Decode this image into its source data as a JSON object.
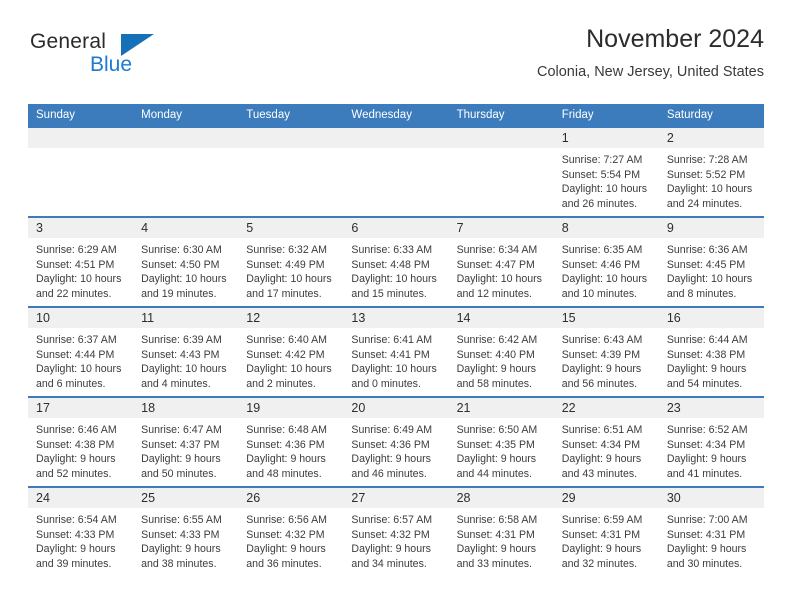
{
  "brand": {
    "name_part1": "General",
    "name_part2": "Blue",
    "logo_icon": "blue-triangle-icon"
  },
  "header": {
    "title": "November 2024",
    "location": "Colonia, New Jersey, United States"
  },
  "colors": {
    "header_blue": "#3c7cbd",
    "brand_blue": "#1c7ad1",
    "daynum_band": "#f0f0f0",
    "text": "#333333"
  },
  "weekday_headers": [
    "Sunday",
    "Monday",
    "Tuesday",
    "Wednesday",
    "Thursday",
    "Friday",
    "Saturday"
  ],
  "labels": {
    "sunrise_prefix": "Sunrise:",
    "sunset_prefix": "Sunset:",
    "daylight_prefix": "Daylight:"
  },
  "weeks": [
    [
      {
        "day": ""
      },
      {
        "day": ""
      },
      {
        "day": ""
      },
      {
        "day": ""
      },
      {
        "day": ""
      },
      {
        "day": "1",
        "sunrise": "Sunrise: 7:27 AM",
        "sunset": "Sunset: 5:54 PM",
        "daylight_l1": "Daylight: 10 hours",
        "daylight_l2": "and 26 minutes."
      },
      {
        "day": "2",
        "sunrise": "Sunrise: 7:28 AM",
        "sunset": "Sunset: 5:52 PM",
        "daylight_l1": "Daylight: 10 hours",
        "daylight_l2": "and 24 minutes."
      }
    ],
    [
      {
        "day": "3",
        "sunrise": "Sunrise: 6:29 AM",
        "sunset": "Sunset: 4:51 PM",
        "daylight_l1": "Daylight: 10 hours",
        "daylight_l2": "and 22 minutes."
      },
      {
        "day": "4",
        "sunrise": "Sunrise: 6:30 AM",
        "sunset": "Sunset: 4:50 PM",
        "daylight_l1": "Daylight: 10 hours",
        "daylight_l2": "and 19 minutes."
      },
      {
        "day": "5",
        "sunrise": "Sunrise: 6:32 AM",
        "sunset": "Sunset: 4:49 PM",
        "daylight_l1": "Daylight: 10 hours",
        "daylight_l2": "and 17 minutes."
      },
      {
        "day": "6",
        "sunrise": "Sunrise: 6:33 AM",
        "sunset": "Sunset: 4:48 PM",
        "daylight_l1": "Daylight: 10 hours",
        "daylight_l2": "and 15 minutes."
      },
      {
        "day": "7",
        "sunrise": "Sunrise: 6:34 AM",
        "sunset": "Sunset: 4:47 PM",
        "daylight_l1": "Daylight: 10 hours",
        "daylight_l2": "and 12 minutes."
      },
      {
        "day": "8",
        "sunrise": "Sunrise: 6:35 AM",
        "sunset": "Sunset: 4:46 PM",
        "daylight_l1": "Daylight: 10 hours",
        "daylight_l2": "and 10 minutes."
      },
      {
        "day": "9",
        "sunrise": "Sunrise: 6:36 AM",
        "sunset": "Sunset: 4:45 PM",
        "daylight_l1": "Daylight: 10 hours",
        "daylight_l2": "and 8 minutes."
      }
    ],
    [
      {
        "day": "10",
        "sunrise": "Sunrise: 6:37 AM",
        "sunset": "Sunset: 4:44 PM",
        "daylight_l1": "Daylight: 10 hours",
        "daylight_l2": "and 6 minutes."
      },
      {
        "day": "11",
        "sunrise": "Sunrise: 6:39 AM",
        "sunset": "Sunset: 4:43 PM",
        "daylight_l1": "Daylight: 10 hours",
        "daylight_l2": "and 4 minutes."
      },
      {
        "day": "12",
        "sunrise": "Sunrise: 6:40 AM",
        "sunset": "Sunset: 4:42 PM",
        "daylight_l1": "Daylight: 10 hours",
        "daylight_l2": "and 2 minutes."
      },
      {
        "day": "13",
        "sunrise": "Sunrise: 6:41 AM",
        "sunset": "Sunset: 4:41 PM",
        "daylight_l1": "Daylight: 10 hours",
        "daylight_l2": "and 0 minutes."
      },
      {
        "day": "14",
        "sunrise": "Sunrise: 6:42 AM",
        "sunset": "Sunset: 4:40 PM",
        "daylight_l1": "Daylight: 9 hours",
        "daylight_l2": "and 58 minutes."
      },
      {
        "day": "15",
        "sunrise": "Sunrise: 6:43 AM",
        "sunset": "Sunset: 4:39 PM",
        "daylight_l1": "Daylight: 9 hours",
        "daylight_l2": "and 56 minutes."
      },
      {
        "day": "16",
        "sunrise": "Sunrise: 6:44 AM",
        "sunset": "Sunset: 4:38 PM",
        "daylight_l1": "Daylight: 9 hours",
        "daylight_l2": "and 54 minutes."
      }
    ],
    [
      {
        "day": "17",
        "sunrise": "Sunrise: 6:46 AM",
        "sunset": "Sunset: 4:38 PM",
        "daylight_l1": "Daylight: 9 hours",
        "daylight_l2": "and 52 minutes."
      },
      {
        "day": "18",
        "sunrise": "Sunrise: 6:47 AM",
        "sunset": "Sunset: 4:37 PM",
        "daylight_l1": "Daylight: 9 hours",
        "daylight_l2": "and 50 minutes."
      },
      {
        "day": "19",
        "sunrise": "Sunrise: 6:48 AM",
        "sunset": "Sunset: 4:36 PM",
        "daylight_l1": "Daylight: 9 hours",
        "daylight_l2": "and 48 minutes."
      },
      {
        "day": "20",
        "sunrise": "Sunrise: 6:49 AM",
        "sunset": "Sunset: 4:36 PM",
        "daylight_l1": "Daylight: 9 hours",
        "daylight_l2": "and 46 minutes."
      },
      {
        "day": "21",
        "sunrise": "Sunrise: 6:50 AM",
        "sunset": "Sunset: 4:35 PM",
        "daylight_l1": "Daylight: 9 hours",
        "daylight_l2": "and 44 minutes."
      },
      {
        "day": "22",
        "sunrise": "Sunrise: 6:51 AM",
        "sunset": "Sunset: 4:34 PM",
        "daylight_l1": "Daylight: 9 hours",
        "daylight_l2": "and 43 minutes."
      },
      {
        "day": "23",
        "sunrise": "Sunrise: 6:52 AM",
        "sunset": "Sunset: 4:34 PM",
        "daylight_l1": "Daylight: 9 hours",
        "daylight_l2": "and 41 minutes."
      }
    ],
    [
      {
        "day": "24",
        "sunrise": "Sunrise: 6:54 AM",
        "sunset": "Sunset: 4:33 PM",
        "daylight_l1": "Daylight: 9 hours",
        "daylight_l2": "and 39 minutes."
      },
      {
        "day": "25",
        "sunrise": "Sunrise: 6:55 AM",
        "sunset": "Sunset: 4:33 PM",
        "daylight_l1": "Daylight: 9 hours",
        "daylight_l2": "and 38 minutes."
      },
      {
        "day": "26",
        "sunrise": "Sunrise: 6:56 AM",
        "sunset": "Sunset: 4:32 PM",
        "daylight_l1": "Daylight: 9 hours",
        "daylight_l2": "and 36 minutes."
      },
      {
        "day": "27",
        "sunrise": "Sunrise: 6:57 AM",
        "sunset": "Sunset: 4:32 PM",
        "daylight_l1": "Daylight: 9 hours",
        "daylight_l2": "and 34 minutes."
      },
      {
        "day": "28",
        "sunrise": "Sunrise: 6:58 AM",
        "sunset": "Sunset: 4:31 PM",
        "daylight_l1": "Daylight: 9 hours",
        "daylight_l2": "and 33 minutes."
      },
      {
        "day": "29",
        "sunrise": "Sunrise: 6:59 AM",
        "sunset": "Sunset: 4:31 PM",
        "daylight_l1": "Daylight: 9 hours",
        "daylight_l2": "and 32 minutes."
      },
      {
        "day": "30",
        "sunrise": "Sunrise: 7:00 AM",
        "sunset": "Sunset: 4:31 PM",
        "daylight_l1": "Daylight: 9 hours",
        "daylight_l2": "and 30 minutes."
      }
    ]
  ]
}
